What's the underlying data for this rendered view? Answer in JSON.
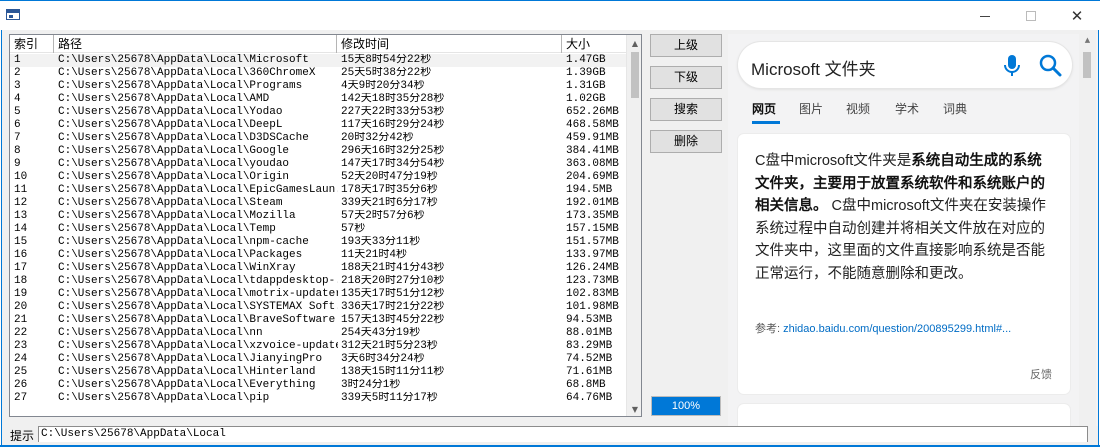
{
  "window": {
    "title": "",
    "controls": [
      "minimize",
      "maximize",
      "close"
    ]
  },
  "list": {
    "columns": {
      "index": "索引",
      "path": "路径",
      "time": "修改时间",
      "size": "大小"
    },
    "rows": [
      {
        "index": "1",
        "path": "C:\\Users\\25678\\AppData\\Local\\Microsoft",
        "time": "15天8时54分22秒",
        "size": "1.47GB"
      },
      {
        "index": "2",
        "path": "C:\\Users\\25678\\AppData\\Local\\360ChromeX",
        "time": "25天5时38分22秒",
        "size": "1.39GB"
      },
      {
        "index": "3",
        "path": "C:\\Users\\25678\\AppData\\Local\\Programs",
        "time": "4天9时20分34秒",
        "size": "1.31GB"
      },
      {
        "index": "4",
        "path": "C:\\Users\\25678\\AppData\\Local\\AMD",
        "time": "142天18时35分28秒",
        "size": "1.02GB"
      },
      {
        "index": "5",
        "path": "C:\\Users\\25678\\AppData\\Local\\Yodao",
        "time": "227天22时33分53秒",
        "size": "652.26MB"
      },
      {
        "index": "6",
        "path": "C:\\Users\\25678\\AppData\\Local\\DeepL",
        "time": "117天16时29分24秒",
        "size": "468.58MB"
      },
      {
        "index": "7",
        "path": "C:\\Users\\25678\\AppData\\Local\\D3DSCache",
        "time": "20时32分42秒",
        "size": "459.91MB"
      },
      {
        "index": "8",
        "path": "C:\\Users\\25678\\AppData\\Local\\Google",
        "time": "296天16时32分25秒",
        "size": "384.41MB"
      },
      {
        "index": "9",
        "path": "C:\\Users\\25678\\AppData\\Local\\youdao",
        "time": "147天17时34分54秒",
        "size": "363.08MB"
      },
      {
        "index": "10",
        "path": "C:\\Users\\25678\\AppData\\Local\\Origin",
        "time": "52天20时47分19秒",
        "size": "204.69MB"
      },
      {
        "index": "11",
        "path": "C:\\Users\\25678\\AppData\\Local\\EpicGamesLaun...",
        "time": "178天17时35分6秒",
        "size": "194.5MB"
      },
      {
        "index": "12",
        "path": "C:\\Users\\25678\\AppData\\Local\\Steam",
        "time": "339天21时6分17秒",
        "size": "192.01MB"
      },
      {
        "index": "13",
        "path": "C:\\Users\\25678\\AppData\\Local\\Mozilla",
        "time": "57天2时57分6秒",
        "size": "173.35MB"
      },
      {
        "index": "14",
        "path": "C:\\Users\\25678\\AppData\\Local\\Temp",
        "time": "57秒",
        "size": "157.15MB"
      },
      {
        "index": "15",
        "path": "C:\\Users\\25678\\AppData\\Local\\npm-cache",
        "time": "193天33分11秒",
        "size": "151.57MB"
      },
      {
        "index": "16",
        "path": "C:\\Users\\25678\\AppData\\Local\\Packages",
        "time": "11天21时4秒",
        "size": "133.97MB"
      },
      {
        "index": "17",
        "path": "C:\\Users\\25678\\AppData\\Local\\WinXray",
        "time": "188天21时41分43秒",
        "size": "126.24MB"
      },
      {
        "index": "18",
        "path": "C:\\Users\\25678\\AppData\\Local\\tdappdesktop-...",
        "time": "218天20时27分10秒",
        "size": "123.73MB"
      },
      {
        "index": "19",
        "path": "C:\\Users\\25678\\AppData\\Local\\motrix-updater",
        "time": "135天17时51分12秒",
        "size": "102.83MB"
      },
      {
        "index": "20",
        "path": "C:\\Users\\25678\\AppData\\Local\\SYSTEMAX Soft...",
        "time": "336天17时21分22秒",
        "size": "101.98MB"
      },
      {
        "index": "21",
        "path": "C:\\Users\\25678\\AppData\\Local\\BraveSoftware",
        "time": "157天13时45分22秒",
        "size": "94.53MB"
      },
      {
        "index": "22",
        "path": "C:\\Users\\25678\\AppData\\Local\\nn",
        "time": "254天43分19秒",
        "size": "88.01MB"
      },
      {
        "index": "23",
        "path": "C:\\Users\\25678\\AppData\\Local\\xzvoice-updater",
        "time": "312天21时5分23秒",
        "size": "83.29MB"
      },
      {
        "index": "24",
        "path": "C:\\Users\\25678\\AppData\\Local\\JianyingPro",
        "time": "3天6时34分24秒",
        "size": "74.52MB"
      },
      {
        "index": "25",
        "path": "C:\\Users\\25678\\AppData\\Local\\Hinterland",
        "time": "138天15时11分11秒",
        "size": "71.61MB"
      },
      {
        "index": "26",
        "path": "C:\\Users\\25678\\AppData\\Local\\Everything",
        "time": "3时24分1秒",
        "size": "68.8MB"
      },
      {
        "index": "27",
        "path": "C:\\Users\\25678\\AppData\\Local\\pip",
        "time": "339天5时11分17秒",
        "size": "64.76MB"
      }
    ]
  },
  "buttons": {
    "up": "上级",
    "down": "下级",
    "search": "搜索",
    "delete": "删除"
  },
  "progress": {
    "label": "100%",
    "value": 1.0
  },
  "web": {
    "query": "Microsoft 文件夹",
    "tabs": [
      "网页",
      "图片",
      "视频",
      "学术",
      "词典"
    ],
    "active_tab": 0,
    "answer": {
      "intro": "C盘中microsoft文件夹是",
      "bold": "系统自动生成的系统文件夹，主要用于放置系统软件和系统账户的相关信息。",
      "rest": " C盘中microsoft文件夹在安装操作系统过程中自动创建并将相关文件放在对应的文件夹中，这里面的文件直接影响系统是否能正常运行，不能随意删除和更改。"
    },
    "ref_label": "参考: ",
    "ref_url": "zhidao.baidu.com/question/200895299.html#...",
    "feedback": "反馈"
  },
  "status": {
    "label": "提示",
    "path": "C:\\Users\\25678\\AppData\\Local"
  },
  "colors": {
    "accent": "#0078d7",
    "link": "#006cc5"
  }
}
